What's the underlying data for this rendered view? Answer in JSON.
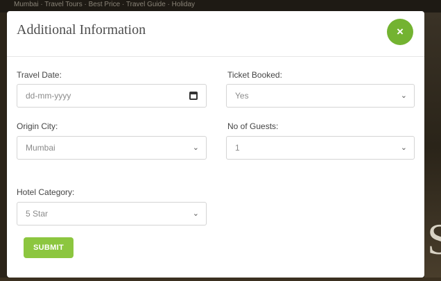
{
  "backdrop": {
    "top_text": "Mumbai · Travel Tours · Best Price · Travel Guide · Holiday",
    "right_letter": "S"
  },
  "modal": {
    "title": "Additional Information",
    "close_icon": "×"
  },
  "fields": {
    "travel_date": {
      "label": "Travel Date:",
      "value": "dd-mm-yyyy"
    },
    "ticket_booked": {
      "label": "Ticket Booked:",
      "value": "Yes"
    },
    "origin_city": {
      "label": "Origin City:",
      "value": "Mumbai"
    },
    "no_of_guests": {
      "label": "No of Guests:",
      "value": "1"
    },
    "hotel_category": {
      "label": "Hotel Category:",
      "value": "5 Star"
    }
  },
  "submit_label": "SUBMIT",
  "colors": {
    "accent_green": "#73b331",
    "button_green": "#8cc63f"
  },
  "icons": {
    "dropdown": "chevron-down-icon",
    "date": "calendar-icon",
    "close": "close-icon"
  }
}
